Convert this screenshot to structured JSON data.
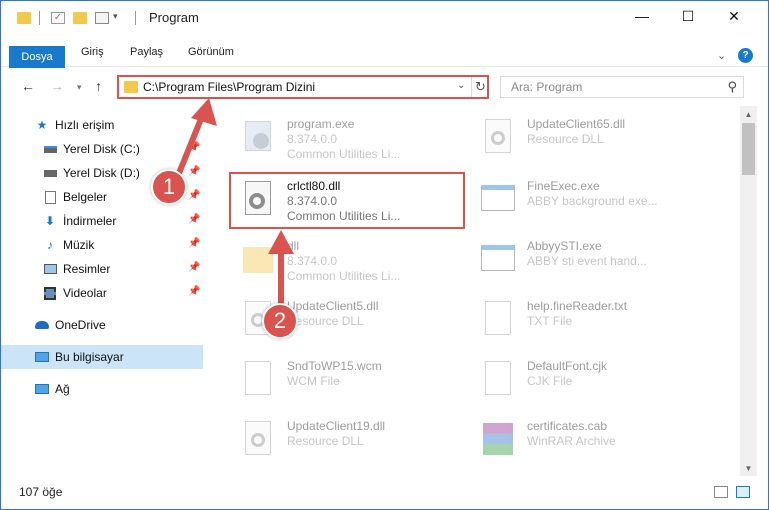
{
  "window": {
    "title": "Program"
  },
  "ribbon": {
    "tabs": [
      "Dosya",
      "Giriş",
      "Paylaş",
      "Görünüm"
    ],
    "help": "?"
  },
  "address": {
    "path": "C:\\Program Files\\Program Dizini"
  },
  "search": {
    "placeholder": "Ara: Program"
  },
  "sidebar": {
    "items": [
      {
        "label": "Hızlı erişim",
        "icon": "star-icon"
      },
      {
        "label": "Yerel Disk (C:)",
        "icon": "drive-icon",
        "pinned": true
      },
      {
        "label": "Yerel Disk (D:)",
        "icon": "drive-icon",
        "pinned": true
      },
      {
        "label": "Belgeler",
        "icon": "documents-icon",
        "pinned": true
      },
      {
        "label": "İndirmeler",
        "icon": "download-icon",
        "pinned": true
      },
      {
        "label": "Müzik",
        "icon": "music-icon",
        "pinned": true
      },
      {
        "label": "Resimler",
        "icon": "pictures-icon",
        "pinned": true
      },
      {
        "label": "Videolar",
        "icon": "videos-icon",
        "pinned": true
      },
      {
        "label": "OneDrive",
        "icon": "cloud-icon"
      },
      {
        "label": "Bu bilgisayar",
        "icon": "computer-icon",
        "selected": true
      },
      {
        "label": "Ağ",
        "icon": "network-icon"
      }
    ]
  },
  "files": [
    {
      "name": "program.exe",
      "line1": "8.374.0.0",
      "line2": "Common Utilities Li...",
      "icon": "exe-icon"
    },
    {
      "name": "UpdateClient65.dll",
      "line1": "Resource DLL",
      "line2": "",
      "icon": "dll-icon"
    },
    {
      "name": "crlctl80.dll",
      "line1": "8.374.0.0",
      "line2": "Common Utilities Li...",
      "icon": "dll-gear-icon",
      "highlight": true
    },
    {
      "name": "FineExec.exe",
      "line1": "ABBY background exe...",
      "line2": "",
      "icon": "app-window-icon"
    },
    {
      "name": "dll",
      "line1": "8.374.0.0",
      "line2": "Common Utilities Li...",
      "icon": "folder-file-icon"
    },
    {
      "name": "AbbyySTI.exe",
      "line1": "ABBY sti event hand...",
      "line2": "",
      "icon": "app-window-icon"
    },
    {
      "name": "UpdateClient5.dll",
      "line1": "Resource DLL",
      "line2": "",
      "icon": "dll-icon"
    },
    {
      "name": "help.fineReader.txt",
      "line1": "TXT File",
      "line2": "",
      "icon": "text-file-icon"
    },
    {
      "name": "SndToWP15.wcm",
      "line1": "WCM File",
      "line2": "",
      "icon": "blank-file-icon"
    },
    {
      "name": "DefaultFont.cjk",
      "line1": "CJK File",
      "line2": "",
      "icon": "blank-file-icon"
    },
    {
      "name": "UpdateClient19.dll",
      "line1": "Resource DLL",
      "line2": "",
      "icon": "dll-icon"
    },
    {
      "name": "certificates.cab",
      "line1": "WinRAR Archive",
      "line2": "",
      "icon": "winrar-icon"
    }
  ],
  "status": {
    "count": "107 öğe"
  },
  "annotations": {
    "step1": "1",
    "step2": "2"
  },
  "colors": {
    "accent": "#1979ca",
    "highlight": "#d9534f",
    "selected": "#cce4f7"
  }
}
